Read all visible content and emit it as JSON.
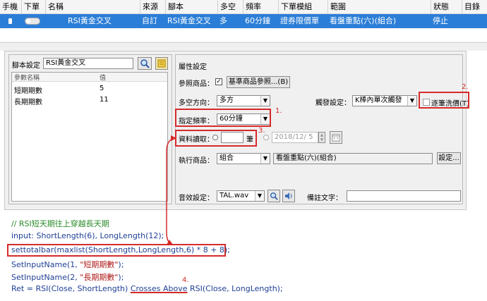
{
  "table": {
    "headers": [
      "手機",
      "下單",
      "名稱",
      "來源",
      "腳本",
      "多空",
      "頻率",
      "下單模組",
      "範圍",
      "狀態",
      "目錄"
    ],
    "row": {
      "name": "RSI黃金交叉",
      "source": "自訂",
      "script": "RSI黃金交叉",
      "direction": "多",
      "frequency": "60分鐘",
      "order_module": "證券限價單",
      "scope": "看盤重點(六)(組合)",
      "status": "停止"
    }
  },
  "left_panel": {
    "script_label": "腳本設定",
    "script_value": "RSI黃金交叉",
    "columns": [
      "參數名稱",
      "值"
    ],
    "params": [
      {
        "name": "短期期數",
        "value": "5"
      },
      {
        "name": "長期期數",
        "value": "11"
      }
    ]
  },
  "right_panel": {
    "title": "屬性設定",
    "ref_label": "參照商品：",
    "ref_check": "✓",
    "ref_button": "基準商品參照...(B)",
    "direction_label": "多空方向：",
    "direction_value": "多方",
    "trigger_label": "觸發設定：",
    "trigger_value": "K棒內單次觸發",
    "wash_label": "逐筆洗價(T)",
    "freq_label": "指定頻率：",
    "freq_value": "60分鐘",
    "data_label": "資料讀取：",
    "data_unit": "筆",
    "date_value": "2018/12/ 5",
    "exec_label": "執行商品：",
    "exec_value": "組合",
    "exec_detail": "看盤重點(六)(組合)",
    "setup_button": "設定...",
    "sound_label": "音效設定：",
    "sound_value": "TAL.wav",
    "memo_label": "備註文字："
  },
  "annotations": {
    "n1": "1.",
    "n2": "2.",
    "n3": "3.",
    "n4": "4."
  },
  "code": {
    "line1": "// RSI短天期往上穿越長天期",
    "line2": "input: ShortLength(6), LongLength(12);",
    "line3": "settotalbar(maxlist(ShortLength,LongLength,6) * 8 + 8);",
    "line4a": "SetInputName(1, ",
    "line4b": "\"短期期數\"",
    "line4c": ");",
    "line5a": "SetInputName(2, ",
    "line5b": "\"長期期數\"",
    "line5c": ");",
    "line6a": "Ret = RSI(Close, ShortLength) ",
    "line6b": "Crosses Above",
    "line6c": " RSI(Close, LongLength);"
  }
}
